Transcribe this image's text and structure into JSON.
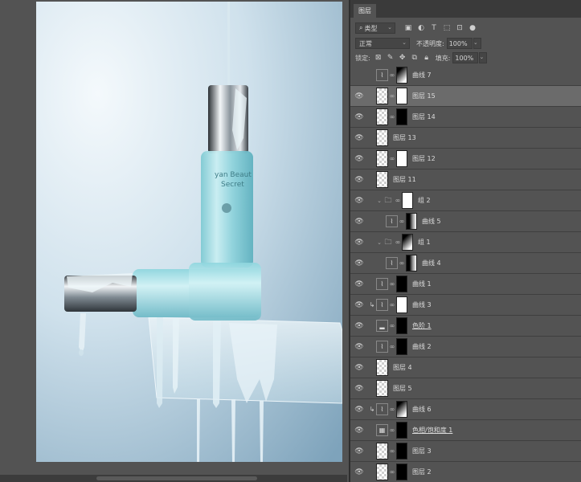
{
  "panel": {
    "tab_label": "图层",
    "filter": {
      "label": "类型"
    },
    "filter_icons": [
      "image-filter-icon",
      "adjustment-filter-icon",
      "type-filter-icon",
      "shape-filter-icon",
      "smart-object-filter-icon",
      "toggle-filter-icon"
    ],
    "blend_mode": "正常",
    "opacity_label": "不透明度:",
    "opacity_value": "100%",
    "lock_label": "锁定:",
    "fill_label": "填充:",
    "fill_value": "100%"
  },
  "layers": [
    {
      "name": "曲线 7",
      "visible": false,
      "type": "adjustment",
      "mask": "grad",
      "clip": false
    },
    {
      "name": "图层 15",
      "visible": true,
      "type": "pixel",
      "mask": "white-shape",
      "clip": false,
      "selected": true
    },
    {
      "name": "图层 14",
      "visible": true,
      "type": "pixel",
      "mask": "black-shape",
      "clip": false
    },
    {
      "name": "图层 13",
      "visible": true,
      "type": "pixel",
      "mask": "",
      "clip": false
    },
    {
      "name": "图层 12",
      "visible": true,
      "type": "pixel",
      "mask": "white",
      "clip": false
    },
    {
      "name": "图层 11",
      "visible": true,
      "type": "pixel",
      "mask": "",
      "clip": false
    },
    {
      "name": "组 2",
      "visible": true,
      "type": "group",
      "mask": "white",
      "clip": false
    },
    {
      "name": "曲线 5",
      "visible": true,
      "type": "adjustment",
      "mask": "gradv",
      "clip": false,
      "indent": true
    },
    {
      "name": "组 1",
      "visible": true,
      "type": "group",
      "mask": "grad",
      "clip": false
    },
    {
      "name": "曲线 4",
      "visible": true,
      "type": "adjustment",
      "mask": "gradv",
      "clip": false,
      "indent": true
    },
    {
      "name": "曲线 1",
      "visible": true,
      "type": "adjustment",
      "mask": "black",
      "clip": false
    },
    {
      "name": "曲线 3",
      "visible": true,
      "type": "adjustment",
      "mask": "white",
      "clip": true
    },
    {
      "name": "色阶 1",
      "visible": true,
      "type": "levels",
      "mask": "black",
      "clip": false
    },
    {
      "name": "曲线 2",
      "visible": true,
      "type": "adjustment",
      "mask": "black",
      "clip": false
    },
    {
      "name": "图层 4",
      "visible": true,
      "type": "pixel",
      "mask": "",
      "clip": false
    },
    {
      "name": "图层 5",
      "visible": true,
      "type": "pixel",
      "mask": "",
      "clip": false
    },
    {
      "name": "曲线 6",
      "visible": true,
      "type": "adjustment",
      "mask": "grad",
      "clip": true
    },
    {
      "name": "色相/饱和度 1",
      "visible": true,
      "type": "huesat",
      "mask": "black",
      "clip": false
    },
    {
      "name": "图层 3",
      "visible": true,
      "type": "pixel",
      "mask": "black",
      "clip": false
    },
    {
      "name": "图层 2",
      "visible": true,
      "type": "pixel",
      "mask": "black",
      "clip": false
    }
  ],
  "canvas": {
    "product_text_1": "yan Beaut",
    "product_text_2": "Secret"
  }
}
